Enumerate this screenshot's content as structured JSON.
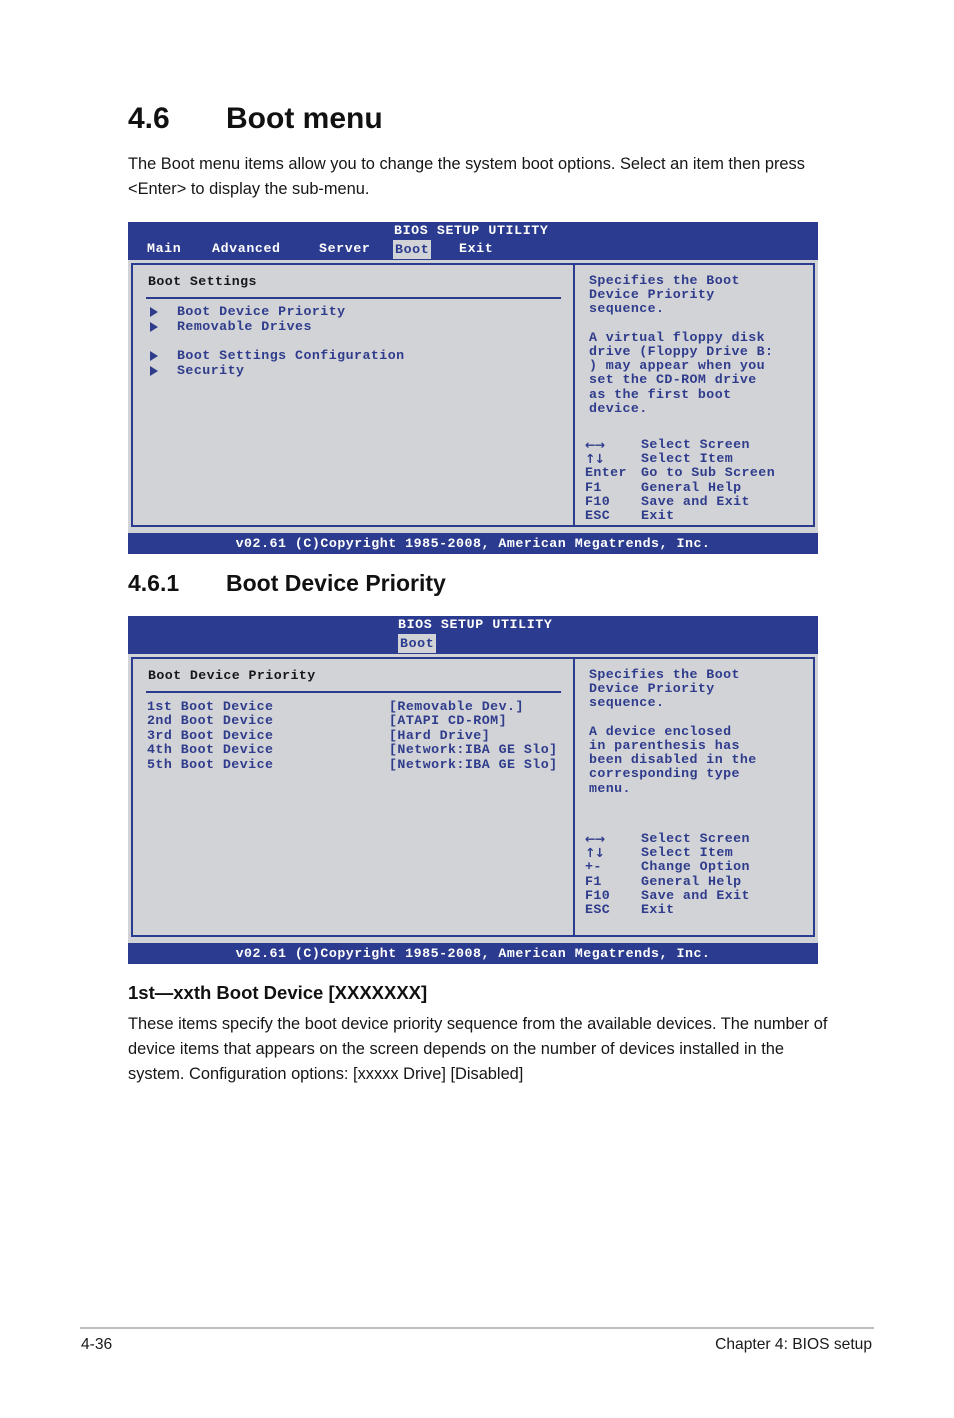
{
  "document": {
    "section_number": "4.6",
    "section_title": "Boot menu",
    "intro_paragraph": "The Boot menu items allow you to change the system boot options. Select an item then press <Enter> to display the sub-menu.",
    "subsection_number": "4.6.1",
    "subsection_title": "Boot Device Priority",
    "item_heading": "1st—xxth Boot Device [XXXXXXX]",
    "item_paragraph": "These items specify the boot device priority sequence from the available devices. The number of device items that appears on the screen depends on the number of devices installed in the system. Configuration options: [xxxxx Drive] [Disabled]"
  },
  "bios_screen_1": {
    "title": "BIOS SETUP UTILITY",
    "menu": {
      "main": "Main",
      "advanced": "Advanced",
      "server": "Server",
      "boot": "Boot",
      "exit": "Exit",
      "active": "Boot"
    },
    "panel_title": "Boot Settings",
    "submenu_items": [
      {
        "label": "Boot Device Priority"
      },
      {
        "label": "Removable Drives"
      },
      {
        "label": "Boot Settings Configuration"
      },
      {
        "label": "Security"
      }
    ],
    "help_text": "Specifies the Boot\nDevice Priority\nsequence.\n\nA virtual floppy disk\ndrive (Floppy Drive B:\n) may appear when you\nset the CD-ROM drive\nas the first boot\ndevice.",
    "legend": [
      {
        "key": "←→",
        "desc": "Select Screen"
      },
      {
        "key": "↑↓",
        "desc": "Select Item"
      },
      {
        "key": "Enter",
        "desc": "Go to Sub Screen"
      },
      {
        "key": "F1",
        "desc": "General Help"
      },
      {
        "key": "F10",
        "desc": "Save and Exit"
      },
      {
        "key": "ESC",
        "desc": "Exit"
      }
    ],
    "footer": "v02.61 (C)Copyright 1985-2008, American Megatrends, Inc."
  },
  "bios_screen_2": {
    "title": "BIOS SETUP UTILITY",
    "menu": {
      "boot": "Boot",
      "active": "Boot"
    },
    "panel_title": "Boot Device Priority",
    "devices": [
      {
        "name": "1st Boot Device",
        "value": "[Removable Dev.]"
      },
      {
        "name": "2nd Boot Device",
        "value": "[ATAPI CD-ROM]"
      },
      {
        "name": "3rd Boot Device",
        "value": "[Hard Drive]"
      },
      {
        "name": "4th Boot Device",
        "value": "[Network:IBA GE Slo]"
      },
      {
        "name": "5th Boot Device",
        "value": "[Network:IBA GE Slo]"
      }
    ],
    "help_text": "Specifies the Boot\nDevice Priority\nsequence.\n\nA device enclosed\nin parenthesis has\nbeen disabled in the\ncorresponding type\nmenu.",
    "legend": [
      {
        "key": "←→",
        "desc": "Select Screen"
      },
      {
        "key": "↑↓",
        "desc": "Select Item"
      },
      {
        "key": "+-",
        "desc": "Change Option"
      },
      {
        "key": "F1",
        "desc": "General Help"
      },
      {
        "key": "F10",
        "desc": "Save and Exit"
      },
      {
        "key": "ESC",
        "desc": "Exit"
      }
    ],
    "footer": "v02.61 (C)Copyright 1985-2008, American Megatrends, Inc."
  },
  "page_footer": {
    "page_number": "4-36",
    "chapter": "Chapter 4: BIOS setup"
  },
  "colors": {
    "bios_blue": "#2b3b8f",
    "bios_gray": "#d2d3d7",
    "bios_text_blue": "#2f3c8c",
    "heading_black": "#111111"
  }
}
